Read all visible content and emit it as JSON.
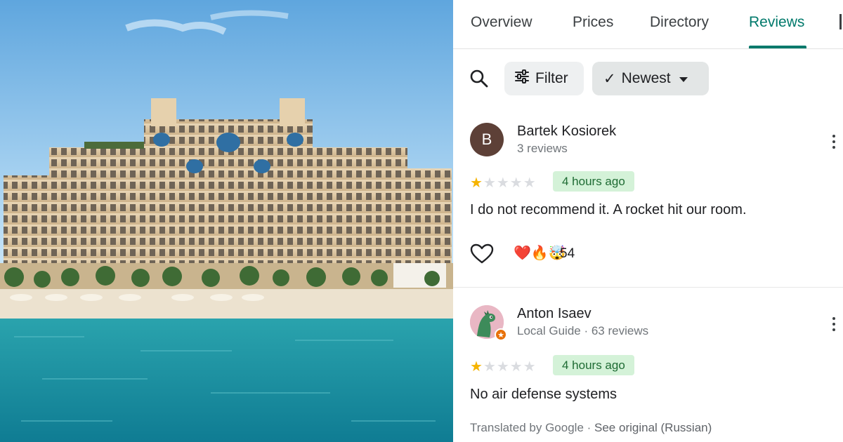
{
  "tabs": [
    {
      "label": "Overview"
    },
    {
      "label": "Prices"
    },
    {
      "label": "Directory"
    },
    {
      "label": "Reviews",
      "active": true
    }
  ],
  "toolbar": {
    "search_icon": "search-icon",
    "filter_label": "Filter",
    "filter_icon": "sliders-icon",
    "sort_label": "Newest",
    "sort_selected_mark": "✓",
    "sort_icon": "caret-down-icon"
  },
  "reviews": [
    {
      "avatar_letter": "B",
      "author": "Bartek Kosiorek",
      "meta": "3 reviews",
      "rating": 1,
      "max_rating": 5,
      "time": "4 hours ago",
      "text": "I do not recommend it. A rocket hit our room.",
      "reactions": "❤️🔥🤯",
      "reaction_count": "54"
    },
    {
      "avatar_icon": "dinosaur-avatar",
      "author": "Anton Isaev",
      "meta": "Local Guide · 63 reviews",
      "rating": 1,
      "max_rating": 5,
      "time": "4 hours ago",
      "text": "No air defense systems",
      "translated_prefix": "Translated by Google · ",
      "see_original": "See original (Russian)"
    }
  ],
  "colors": {
    "accent": "#00796b",
    "star": "#f6b400",
    "badge_bg": "#d4f2d8",
    "badge_text": "#1e6b33",
    "avatar_b": "#5d4037"
  }
}
